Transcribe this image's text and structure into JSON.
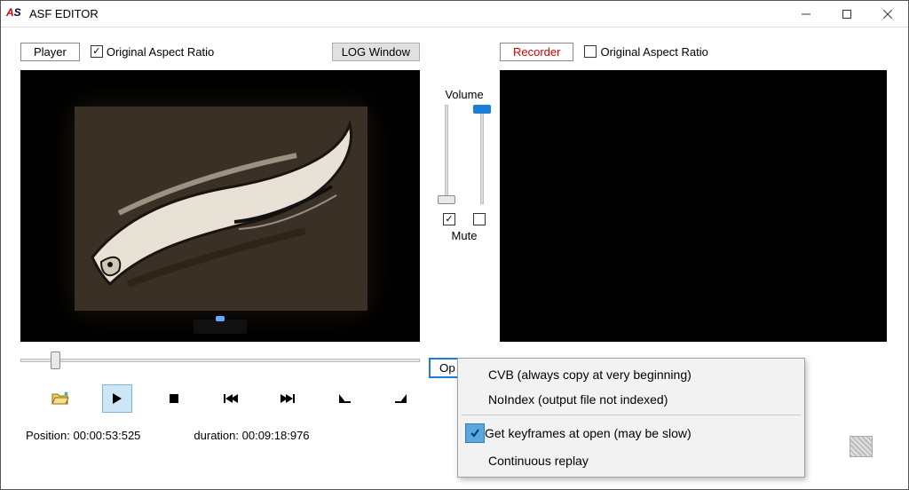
{
  "window": {
    "title": "ASF EDITOR"
  },
  "player": {
    "button": "Player",
    "aspect_label": "Original Aspect Ratio",
    "aspect_checked": true,
    "log_button": "LOG Window"
  },
  "recorder": {
    "button": "Recorder",
    "aspect_label": "Original Aspect Ratio",
    "aspect_checked": false
  },
  "volume": {
    "label": "Volume",
    "mute_label": "Mute",
    "left_mute_checked": true,
    "right_mute_checked": false,
    "left_value": 0,
    "right_value": 100
  },
  "options": {
    "button": "Options",
    "button_visible_text": "Op",
    "items": [
      {
        "label": "CVB (always copy at very beginning)",
        "checked": false
      },
      {
        "label": "NoIndex (output file not indexed)",
        "checked": false
      }
    ],
    "items2": [
      {
        "label": "Get keyframes at open (may be slow)",
        "checked": true
      },
      {
        "label": "Continuous replay",
        "checked": false
      }
    ]
  },
  "status": {
    "position_label": "Position:",
    "position_value": "00:00:53:525",
    "duration_label": "duration:",
    "duration_value": "00:09:18:976"
  }
}
